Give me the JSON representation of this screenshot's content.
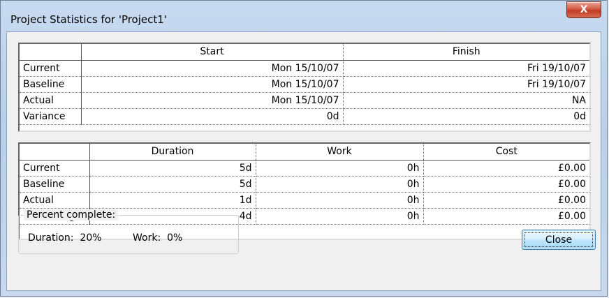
{
  "window": {
    "title": "Project Statistics for 'Project1'",
    "close_glyph": "X"
  },
  "dates_table": {
    "headers": [
      "",
      "Start",
      "Finish"
    ],
    "rows": [
      {
        "label": "Current",
        "start": "Mon 15/10/07",
        "finish": "Fri 19/10/07"
      },
      {
        "label": "Baseline",
        "start": "Mon 15/10/07",
        "finish": "Fri 19/10/07"
      },
      {
        "label": "Actual",
        "start": "Mon 15/10/07",
        "finish": "NA"
      },
      {
        "label": "Variance",
        "start": "0d",
        "finish": "0d"
      }
    ]
  },
  "effort_table": {
    "headers": [
      "",
      "Duration",
      "Work",
      "Cost"
    ],
    "rows": [
      {
        "label": "Current",
        "duration": "5d",
        "work": "0h",
        "cost": "£0.00"
      },
      {
        "label": "Baseline",
        "duration": "5d",
        "work": "0h",
        "cost": "£0.00"
      },
      {
        "label": "Actual",
        "duration": "1d",
        "work": "0h",
        "cost": "£0.00"
      },
      {
        "label": "Remaining",
        "duration": "4d",
        "work": "0h",
        "cost": "£0.00"
      }
    ]
  },
  "percent_complete": {
    "label": "Percent complete:",
    "duration": "Duration:  20%",
    "work": "Work:  0%"
  },
  "buttons": {
    "close": "Close"
  }
}
